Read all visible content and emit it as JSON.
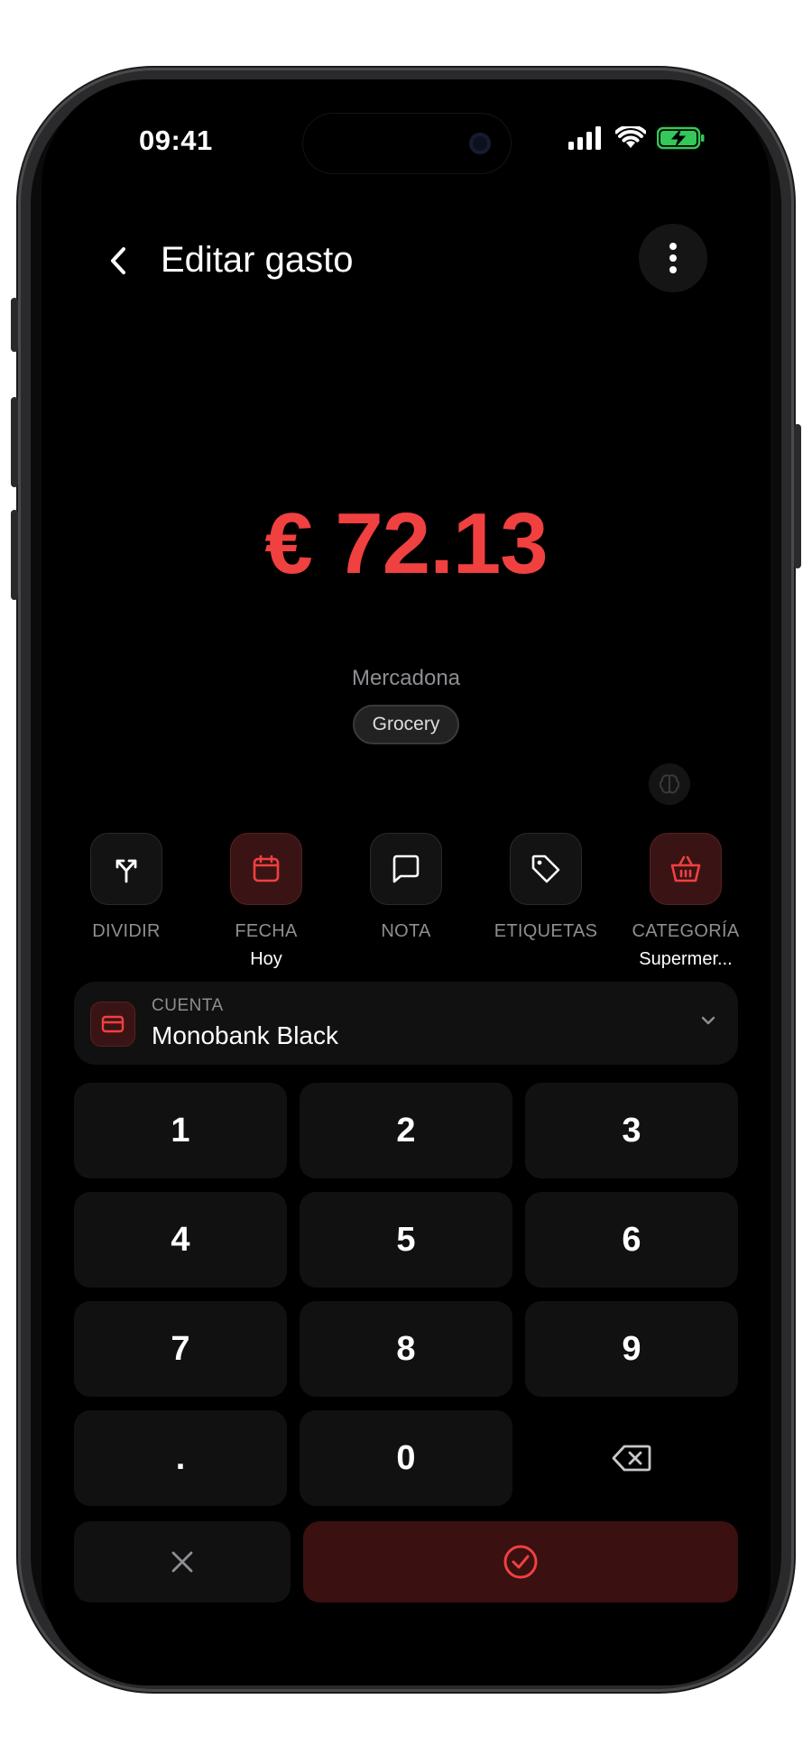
{
  "status_bar": {
    "time": "09:41"
  },
  "header": {
    "title": "Editar gasto"
  },
  "expense": {
    "amount": "€ 72.13",
    "merchant": "Mercadona",
    "tag": "Grocery"
  },
  "actions": [
    {
      "label": "DIVIDIR",
      "value": "",
      "icon": "split-icon"
    },
    {
      "label": "FECHA",
      "value": "Hoy",
      "icon": "calendar-icon"
    },
    {
      "label": "NOTA",
      "value": "",
      "icon": "note-icon"
    },
    {
      "label": "ETIQUETAS",
      "value": "",
      "icon": "tag-icon"
    },
    {
      "label": "CATEGORÍA",
      "value": "Supermer...",
      "icon": "basket-icon"
    }
  ],
  "account": {
    "label": "CUENTA",
    "value": "Monobank Black"
  },
  "keypad": [
    "1",
    "2",
    "3",
    "4",
    "5",
    "6",
    "7",
    "8",
    "9",
    ".",
    "0"
  ],
  "colors": {
    "accent": "#f04040",
    "accent_bg": "#3a1414",
    "battery": "#34c759"
  }
}
